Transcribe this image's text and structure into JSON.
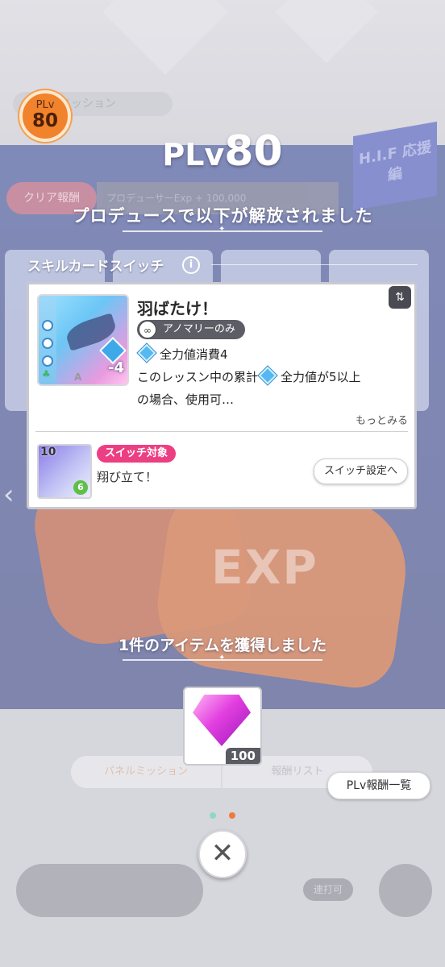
{
  "background": {
    "mission_label": "ルミッション",
    "badge_text": "H.I.F 応援編",
    "clear_label": "クリア報酬",
    "clear_bar_text": "プロデューサーExp + 100,000",
    "exp_text": "EXP",
    "tab_left": "パネルミッション",
    "tab_right": "報酬リスト",
    "dock_mini_label": "連打可"
  },
  "plv_badge": {
    "small": "PLv",
    "big": "80"
  },
  "header": {
    "title_prefix": "PLv",
    "title_number": "80",
    "subtitle": "プロデュースで以下が解放されました"
  },
  "skill_section": {
    "label": "スキルカードスイッチ",
    "card": {
      "name": "羽ばたけ！",
      "cost": "-4",
      "grade": "A",
      "tag": "アノマリーのみ",
      "effect_1": "全力値消費4",
      "effect_2_prefix": "このレッスン中の累計",
      "effect_2_suffix": "全力値が5以上",
      "effect_3": "の場合、使用可…",
      "more": "もっとみる"
    },
    "switch_target": {
      "level": "10",
      "cost": "6",
      "tag": "スイッチ対象",
      "name": "翔び立て！",
      "button": "スイッチ設定へ"
    }
  },
  "items": {
    "heading": "1件のアイテムを獲得しました",
    "count": "100"
  },
  "reward_button": "PLv報酬一覧",
  "colors": {
    "accent_orange": "#f0832b",
    "switch_pink": "#ec3f83",
    "dot_active": "#f07a3a",
    "dot_inactive": "#8fd6c9"
  }
}
